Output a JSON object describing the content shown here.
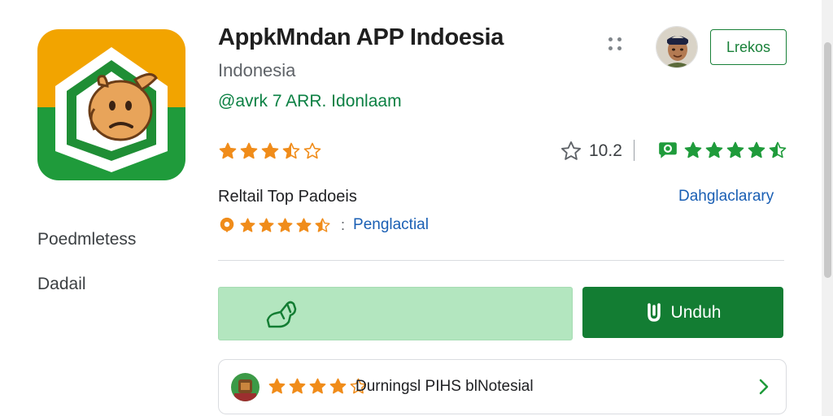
{
  "app": {
    "title": "AppkMndan APP Indoesia",
    "subtitle": "Indonesia",
    "developer": "@avrk 7 ARR. Idonlaam",
    "follow_label": "Lrekos"
  },
  "rating": {
    "stars": 3.5,
    "count": "10.2",
    "badge_stars": 4.5
  },
  "info": {
    "category": "Reltail Top Padoeis",
    "category_link": "Dahglaclarary",
    "sub_stars": 4.5,
    "sub_link": "Penglactial",
    "separator": ":"
  },
  "sidebar": {
    "items": [
      {
        "label": "Poedmletess"
      },
      {
        "label": "Dadail"
      }
    ]
  },
  "actions": {
    "install_label": "Unduh",
    "share_icon": "share-hand-icon",
    "install_icon": "download-icon"
  },
  "review": {
    "stars": 4,
    "text": "Durningsl PIHS blNotesial"
  },
  "colors": {
    "accent_green": "#137d33",
    "star_orange": "#f08c1a",
    "link_blue": "#1a5fb4",
    "share_bg": "#b3e6bf"
  }
}
